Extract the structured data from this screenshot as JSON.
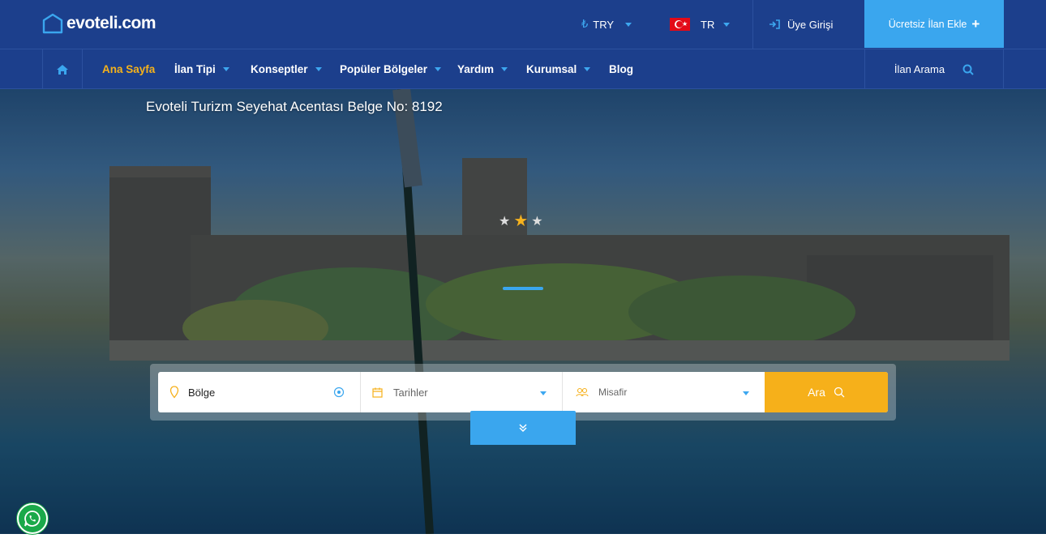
{
  "logo": {
    "text": "evoteli.com"
  },
  "header": {
    "currency": "TRY",
    "currency_symbol": "₺",
    "language": "TR",
    "login_label": "Üye Girişi",
    "cta_label": "Ücretsiz İlan Ekle",
    "cta_color": "#3aa6ee",
    "brand_color": "#1c3f8c",
    "accent_color": "#f6b01a"
  },
  "nav": {
    "items": [
      {
        "label": "Ana Sayfa"
      },
      {
        "label": "İlan Tipi"
      },
      {
        "label": "Konseptler"
      },
      {
        "label": "Popüler Bölgeler"
      },
      {
        "label": "Yardım"
      },
      {
        "label": "Kurumsal"
      },
      {
        "label": "Blog"
      }
    ],
    "search_label": "İlan Arama"
  },
  "hero": {
    "badge": "Evoteli Turizm Seyehat Acentası Belge No: 8192",
    "star_rating": 3
  },
  "search": {
    "region_value": "Bölge",
    "dates_placeholder": "Tarihler",
    "guests_placeholder": "Misafir",
    "button_label": "Ara"
  }
}
